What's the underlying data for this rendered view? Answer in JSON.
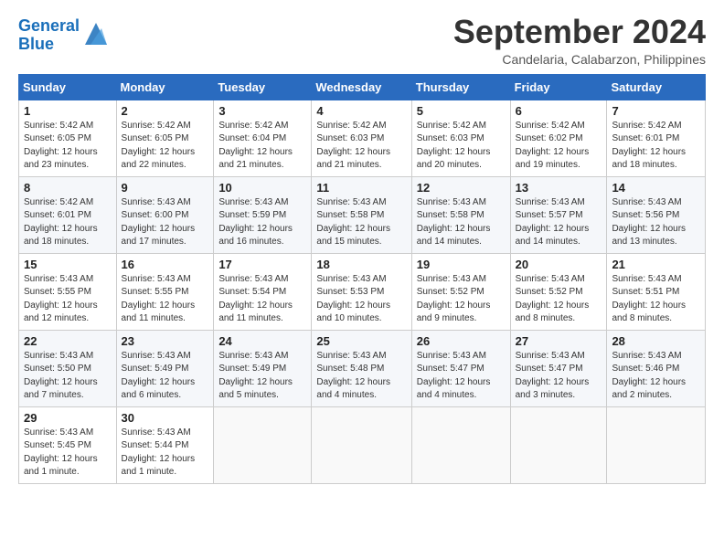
{
  "app": {
    "logo_line1": "General",
    "logo_line2": "Blue"
  },
  "header": {
    "month": "September 2024",
    "location": "Candelaria, Calabarzon, Philippines"
  },
  "weekdays": [
    "Sunday",
    "Monday",
    "Tuesday",
    "Wednesday",
    "Thursday",
    "Friday",
    "Saturday"
  ],
  "weeks": [
    [
      {
        "day": "1",
        "info": "Sunrise: 5:42 AM\nSunset: 6:05 PM\nDaylight: 12 hours\nand 23 minutes."
      },
      {
        "day": "2",
        "info": "Sunrise: 5:42 AM\nSunset: 6:05 PM\nDaylight: 12 hours\nand 22 minutes."
      },
      {
        "day": "3",
        "info": "Sunrise: 5:42 AM\nSunset: 6:04 PM\nDaylight: 12 hours\nand 21 minutes."
      },
      {
        "day": "4",
        "info": "Sunrise: 5:42 AM\nSunset: 6:03 PM\nDaylight: 12 hours\nand 21 minutes."
      },
      {
        "day": "5",
        "info": "Sunrise: 5:42 AM\nSunset: 6:03 PM\nDaylight: 12 hours\nand 20 minutes."
      },
      {
        "day": "6",
        "info": "Sunrise: 5:42 AM\nSunset: 6:02 PM\nDaylight: 12 hours\nand 19 minutes."
      },
      {
        "day": "7",
        "info": "Sunrise: 5:42 AM\nSunset: 6:01 PM\nDaylight: 12 hours\nand 18 minutes."
      }
    ],
    [
      {
        "day": "8",
        "info": "Sunrise: 5:42 AM\nSunset: 6:01 PM\nDaylight: 12 hours\nand 18 minutes."
      },
      {
        "day": "9",
        "info": "Sunrise: 5:43 AM\nSunset: 6:00 PM\nDaylight: 12 hours\nand 17 minutes."
      },
      {
        "day": "10",
        "info": "Sunrise: 5:43 AM\nSunset: 5:59 PM\nDaylight: 12 hours\nand 16 minutes."
      },
      {
        "day": "11",
        "info": "Sunrise: 5:43 AM\nSunset: 5:58 PM\nDaylight: 12 hours\nand 15 minutes."
      },
      {
        "day": "12",
        "info": "Sunrise: 5:43 AM\nSunset: 5:58 PM\nDaylight: 12 hours\nand 14 minutes."
      },
      {
        "day": "13",
        "info": "Sunrise: 5:43 AM\nSunset: 5:57 PM\nDaylight: 12 hours\nand 14 minutes."
      },
      {
        "day": "14",
        "info": "Sunrise: 5:43 AM\nSunset: 5:56 PM\nDaylight: 12 hours\nand 13 minutes."
      }
    ],
    [
      {
        "day": "15",
        "info": "Sunrise: 5:43 AM\nSunset: 5:55 PM\nDaylight: 12 hours\nand 12 minutes."
      },
      {
        "day": "16",
        "info": "Sunrise: 5:43 AM\nSunset: 5:55 PM\nDaylight: 12 hours\nand 11 minutes."
      },
      {
        "day": "17",
        "info": "Sunrise: 5:43 AM\nSunset: 5:54 PM\nDaylight: 12 hours\nand 11 minutes."
      },
      {
        "day": "18",
        "info": "Sunrise: 5:43 AM\nSunset: 5:53 PM\nDaylight: 12 hours\nand 10 minutes."
      },
      {
        "day": "19",
        "info": "Sunrise: 5:43 AM\nSunset: 5:52 PM\nDaylight: 12 hours\nand 9 minutes."
      },
      {
        "day": "20",
        "info": "Sunrise: 5:43 AM\nSunset: 5:52 PM\nDaylight: 12 hours\nand 8 minutes."
      },
      {
        "day": "21",
        "info": "Sunrise: 5:43 AM\nSunset: 5:51 PM\nDaylight: 12 hours\nand 8 minutes."
      }
    ],
    [
      {
        "day": "22",
        "info": "Sunrise: 5:43 AM\nSunset: 5:50 PM\nDaylight: 12 hours\nand 7 minutes."
      },
      {
        "day": "23",
        "info": "Sunrise: 5:43 AM\nSunset: 5:49 PM\nDaylight: 12 hours\nand 6 minutes."
      },
      {
        "day": "24",
        "info": "Sunrise: 5:43 AM\nSunset: 5:49 PM\nDaylight: 12 hours\nand 5 minutes."
      },
      {
        "day": "25",
        "info": "Sunrise: 5:43 AM\nSunset: 5:48 PM\nDaylight: 12 hours\nand 4 minutes."
      },
      {
        "day": "26",
        "info": "Sunrise: 5:43 AM\nSunset: 5:47 PM\nDaylight: 12 hours\nand 4 minutes."
      },
      {
        "day": "27",
        "info": "Sunrise: 5:43 AM\nSunset: 5:47 PM\nDaylight: 12 hours\nand 3 minutes."
      },
      {
        "day": "28",
        "info": "Sunrise: 5:43 AM\nSunset: 5:46 PM\nDaylight: 12 hours\nand 2 minutes."
      }
    ],
    [
      {
        "day": "29",
        "info": "Sunrise: 5:43 AM\nSunset: 5:45 PM\nDaylight: 12 hours\nand 1 minute."
      },
      {
        "day": "30",
        "info": "Sunrise: 5:43 AM\nSunset: 5:44 PM\nDaylight: 12 hours\nand 1 minute."
      },
      {
        "day": "",
        "info": ""
      },
      {
        "day": "",
        "info": ""
      },
      {
        "day": "",
        "info": ""
      },
      {
        "day": "",
        "info": ""
      },
      {
        "day": "",
        "info": ""
      }
    ]
  ]
}
